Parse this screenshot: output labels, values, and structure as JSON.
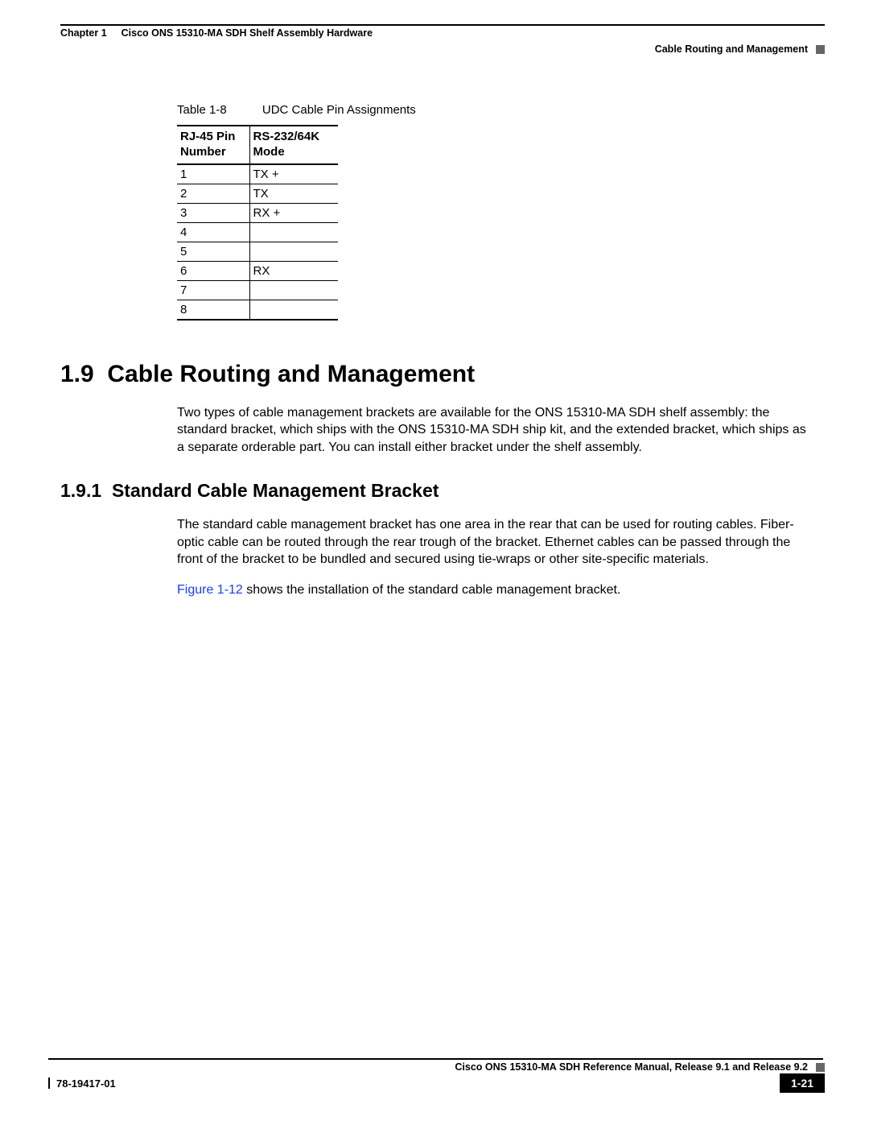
{
  "header": {
    "chapter_label": "Chapter 1",
    "chapter_title": "Cisco ONS 15310-MA SDH Shelf Assembly Hardware",
    "section_label": "Cable Routing and Management"
  },
  "table": {
    "caption_label": "Table 1-8",
    "caption_title": "UDC Cable Pin Assignments",
    "head_col1_l1": "RJ-45 Pin",
    "head_col1_l2": "Number",
    "head_col2_l1": "RS-232/64K",
    "head_col2_l2": "Mode",
    "rows": [
      {
        "pin": "1",
        "mode": "TX +"
      },
      {
        "pin": "2",
        "mode": "TX"
      },
      {
        "pin": "3",
        "mode": "RX +"
      },
      {
        "pin": "4",
        "mode": ""
      },
      {
        "pin": "5",
        "mode": ""
      },
      {
        "pin": "6",
        "mode": "RX"
      },
      {
        "pin": "7",
        "mode": ""
      },
      {
        "pin": "8",
        "mode": ""
      }
    ]
  },
  "headings": {
    "h1_num": "1.9",
    "h1_title": "Cable Routing and Management",
    "h2_num": "1.9.1",
    "h2_title": "Standard Cable Management Bracket"
  },
  "paragraphs": {
    "p1": "Two types of cable management brackets are available for the ONS 15310-MA SDH shelf assembly: the standard bracket, which ships with the ONS 15310-MA SDH ship kit, and the extended bracket, which ships as a separate orderable part. You can install either bracket under the shelf assembly.",
    "p2": "The standard cable management bracket has one area in the rear that can be used for routing cables. Fiber-optic cable can be routed through the rear trough of the bracket. Ethernet cables can be passed through the front of the bracket to be bundled and secured using tie-wraps or other site-specific materials.",
    "p3_link": "Figure 1-12",
    "p3_rest": " shows the installation of the standard cable management bracket."
  },
  "footer": {
    "manual_title": "Cisco ONS 15310-MA SDH Reference Manual, Release 9.1 and Release 9.2",
    "doc_number": "78-19417-01",
    "page_number": "1-21"
  }
}
